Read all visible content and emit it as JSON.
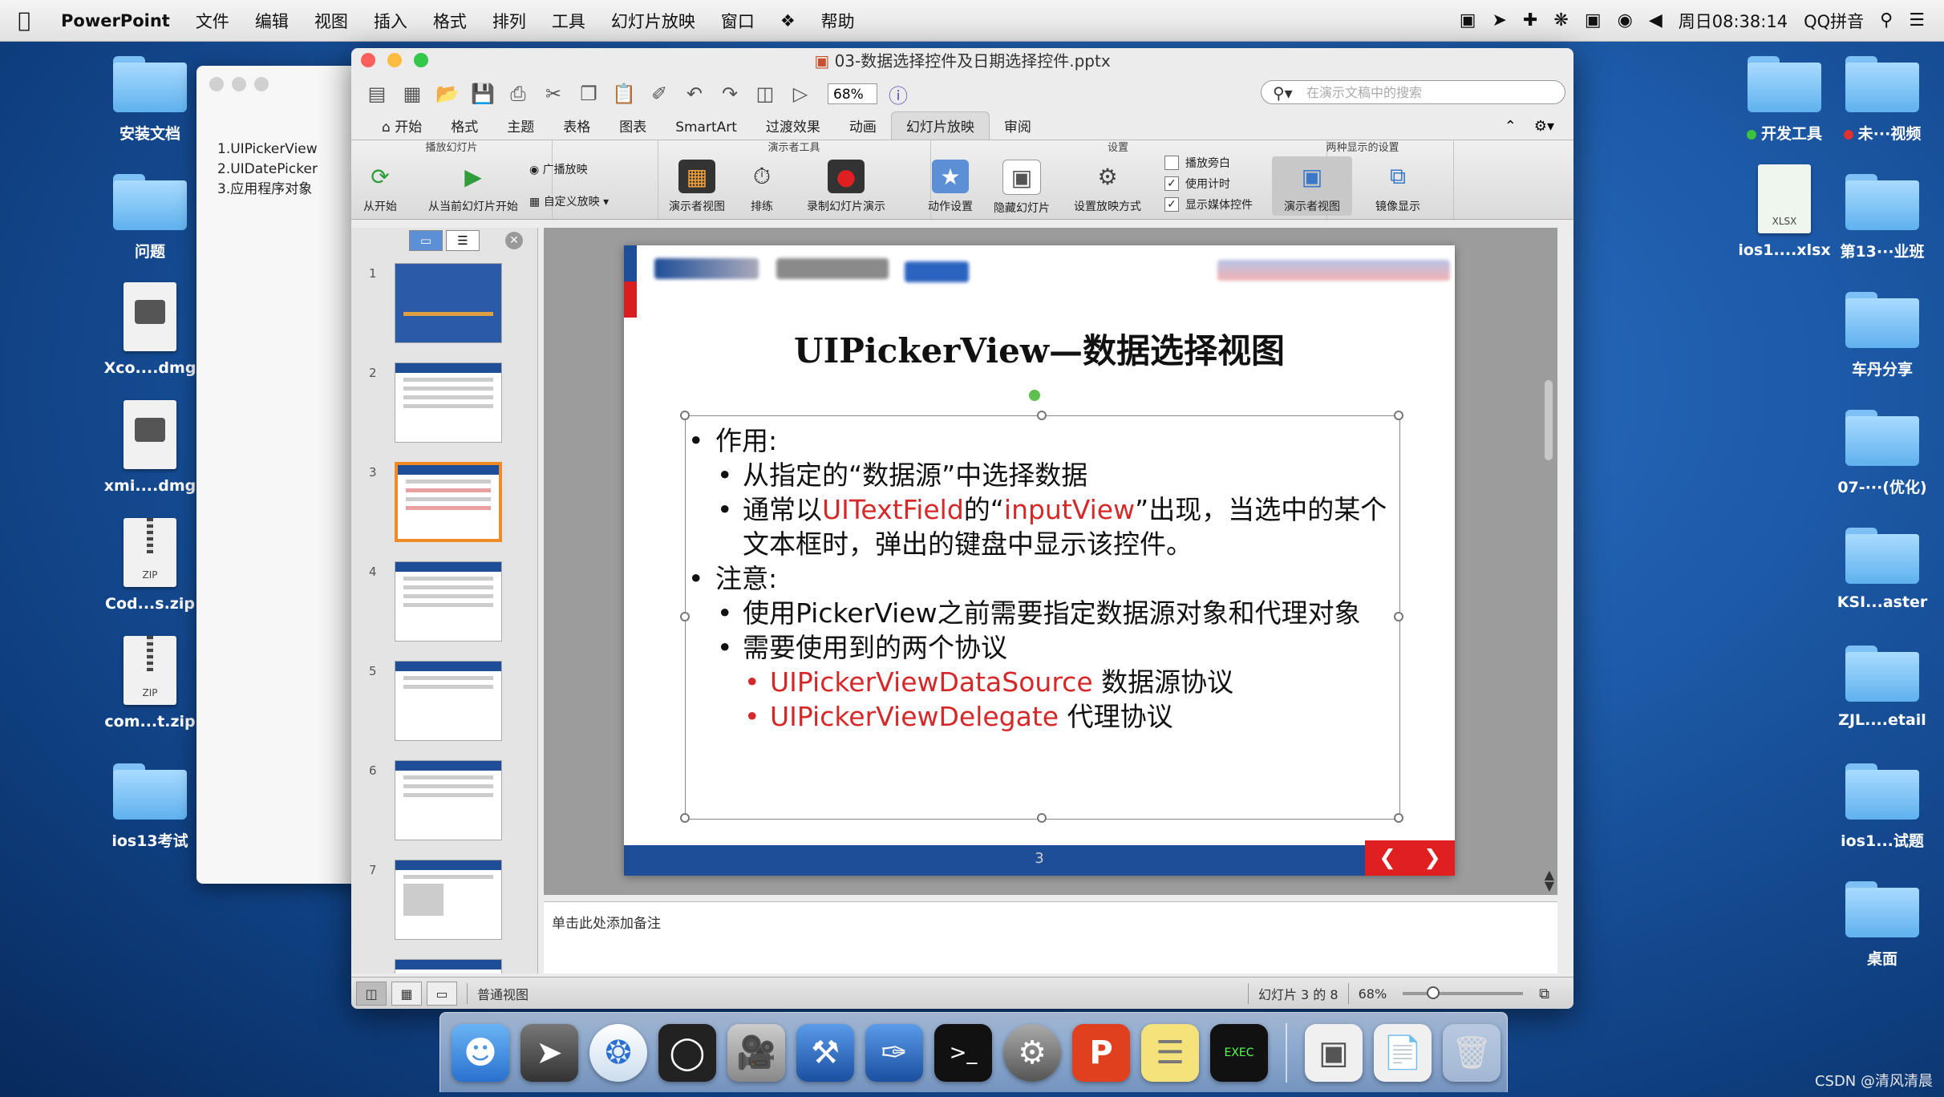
{
  "menubar": {
    "app": "PowerPoint",
    "items": [
      "文件",
      "编辑",
      "视图",
      "插入",
      "格式",
      "排列",
      "工具",
      "幻灯片放映",
      "窗口",
      "帮助"
    ],
    "clock": "周日08:38:14",
    "input_method": "QQ拼音"
  },
  "desktop_left": [
    {
      "label": "安装文档",
      "kind": "folder"
    },
    {
      "label": "问题",
      "kind": "folder"
    },
    {
      "label": "Xco....dmg",
      "kind": "dmg"
    },
    {
      "label": "xmi....dmg",
      "kind": "dmg"
    },
    {
      "label": "Cod...s.zip",
      "kind": "zip"
    },
    {
      "label": "com...t.zip",
      "kind": "zip"
    },
    {
      "label": "ios13考试",
      "kind": "folder"
    }
  ],
  "desktop_right": {
    "dev_tools": "开发工具",
    "video": "未···视频",
    "xlsx": "ios1....xlsx",
    "xlsx_badge": "XLSX",
    "folders": [
      "第13···业班",
      "车丹分享",
      "07-···(优化)",
      "KSI...aster",
      "ZJL....etail",
      "ios1...试题",
      "桌面"
    ]
  },
  "outline_window": {
    "lines": [
      "1.UIPickerView",
      "2.UIDatePicker",
      "3.应用程序对象"
    ]
  },
  "window": {
    "title": "03-数据选择控件及日期选择控件.pptx",
    "zoom": "68%",
    "search_placeholder": "在演示文稿中的搜索"
  },
  "ribbon_tabs": [
    "开始",
    "格式",
    "主题",
    "表格",
    "图表",
    "SmartArt",
    "过渡效果",
    "动画",
    "幻灯片放映",
    "审阅"
  ],
  "ribbon_active": "幻灯片放映",
  "ribbon": {
    "group_play": "播放幻灯片",
    "from_start": "从开始",
    "from_current": "从当前幻灯片开始",
    "broadcast": "广播放映",
    "custom_show": "自定义放映",
    "group_presenter": "演示者工具",
    "presenter_view": "演示者视图",
    "rehearse": "排练",
    "record": "录制幻灯片演示",
    "group_setup": "设置",
    "action_settings": "动作设置",
    "hide_slide": "隐藏幻灯片",
    "setup_show": "设置放映方式",
    "play_narration": "播放旁白",
    "use_timings": "使用计时",
    "show_media": "显示媒体控件",
    "group_dual": "两种显示的设置",
    "presenter_view2": "演示者视图",
    "mirror": "镜像显示"
  },
  "thumbnails": [
    "1",
    "2",
    "3",
    "4",
    "5",
    "6",
    "7"
  ],
  "selected_slide": 3,
  "slide": {
    "title": "UIPickerView—数据选择视图",
    "bullet1": "作用:",
    "b1_sub1": "从指定的“数据源”中选择数据",
    "b1_sub2_pre": "通常以",
    "b1_sub2_red1": "UITextField",
    "b1_sub2_mid": "的“",
    "b1_sub2_red2": "inputView",
    "b1_sub2_post": "”出现，当选中的某个文本框时，弹出的键盘中显示该控件。",
    "bullet2": "注意:",
    "b2_sub1": "使用PickerView之前需要指定数据源对象和代理对象",
    "b2_sub2": "需要使用到的两个协议",
    "p1_red": "UIPickerViewDataSource",
    "p1_txt": " 数据源协议",
    "p2_red": "UIPickerViewDelegate",
    "p2_txt": " 代理协议",
    "page_num": "3"
  },
  "notes_placeholder": "单击此处添加备注",
  "status": {
    "view": "普通视图",
    "slide_of": "幻灯片 3 的 8",
    "zoom": "68%"
  },
  "watermark": "CSDN @清风清晨",
  "colors": {
    "accent_red": "#d62828",
    "slide_blue": "#1f4e99",
    "thumb_selected": "#f08a24"
  }
}
